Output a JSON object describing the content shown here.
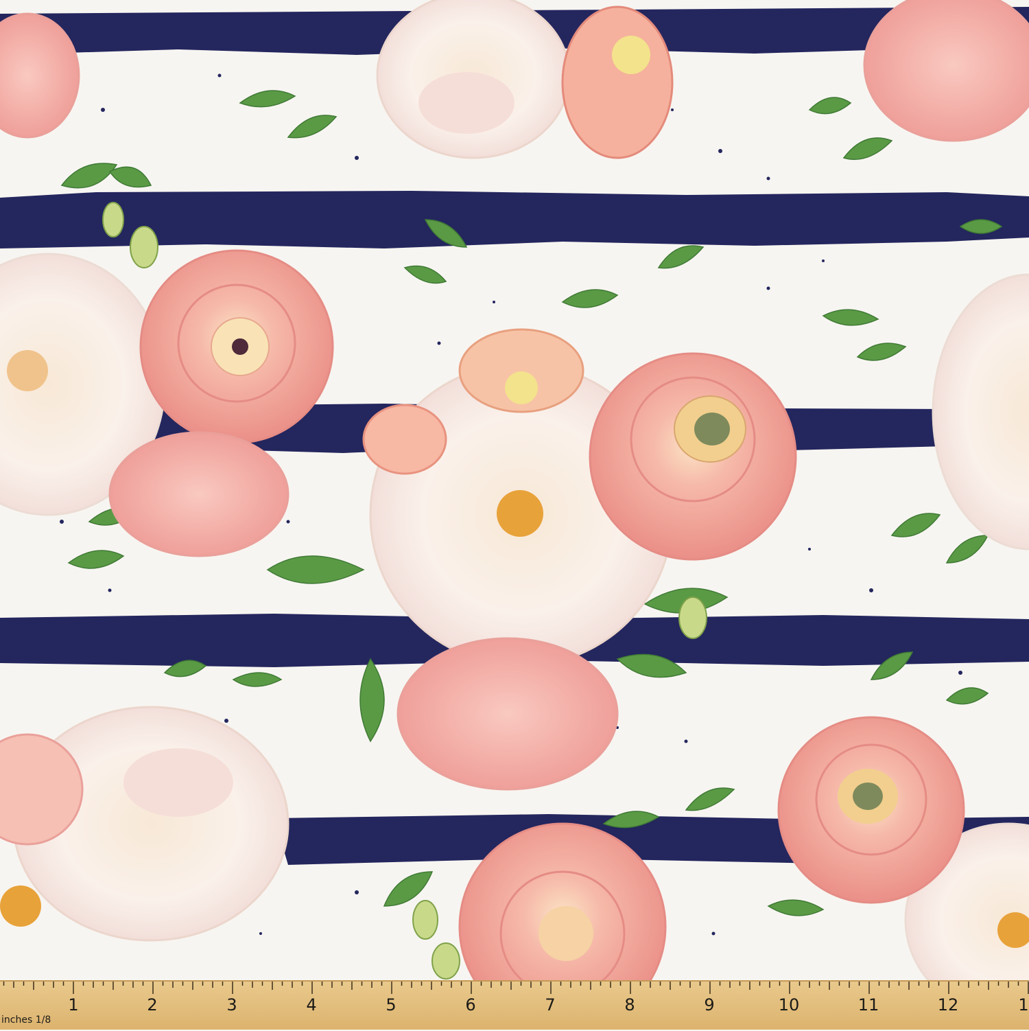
{
  "image": {
    "subject": "floral-fabric-swatch",
    "colors": {
      "background": "#f7f5f1",
      "stripe": "#24265e",
      "pink_rose": "#f2a7a0",
      "pink_rose_dark": "#e07e78",
      "white_petal": "#fbf4ee",
      "leaf": "#5b9a45",
      "leaf_dark": "#3f7a35",
      "yellow_center": "#e8a23a",
      "ruler": "#e4c07f"
    }
  },
  "ruler": {
    "unit_label": "inches 1/8",
    "numbers": [
      "1",
      "2",
      "3",
      "4",
      "5",
      "6",
      "7",
      "8",
      "9",
      "10",
      "11",
      "12",
      "1"
    ]
  }
}
